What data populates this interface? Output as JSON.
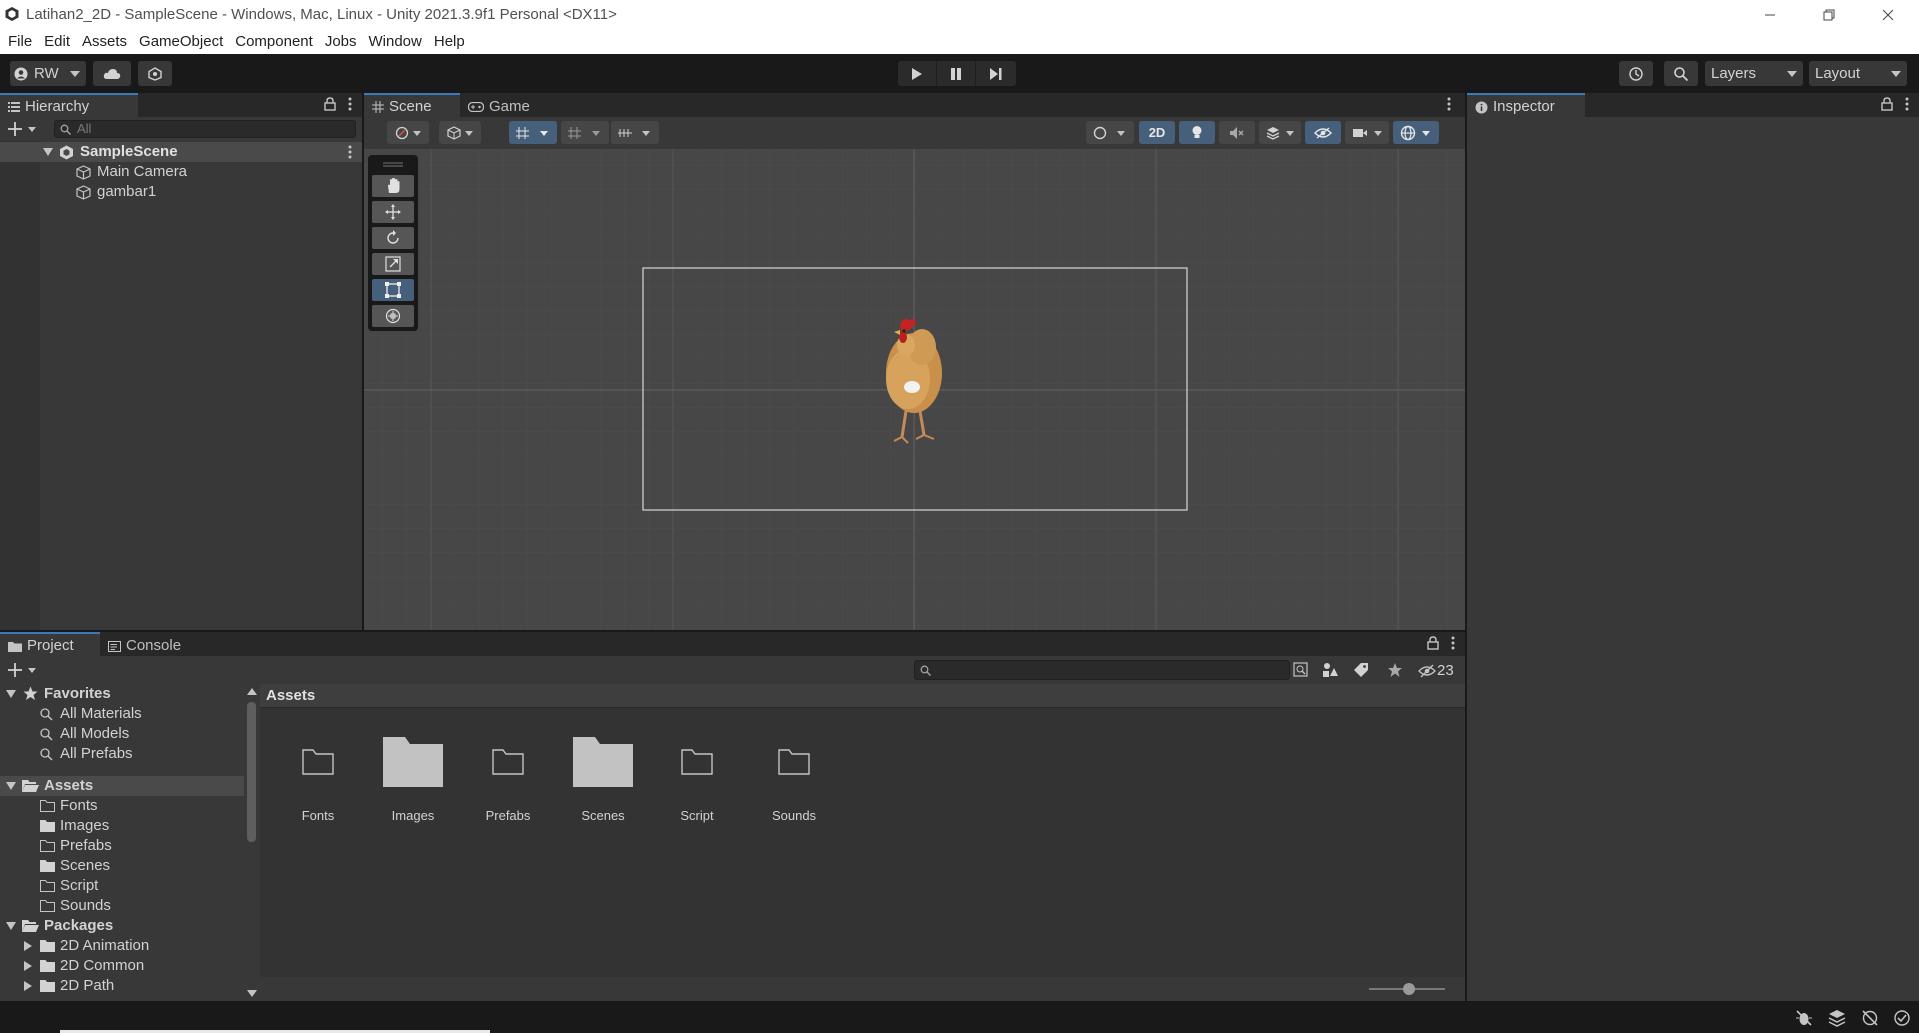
{
  "window": {
    "title": "Latihan2_2D - SampleScene - Windows, Mac, Linux - Unity 2021.3.9f1 Personal <DX11>"
  },
  "menu": [
    "File",
    "Edit",
    "Assets",
    "GameObject",
    "Component",
    "Jobs",
    "Window",
    "Help"
  ],
  "toolbar": {
    "account_label": "RW",
    "layers_label": "Layers",
    "layout_label": "Layout"
  },
  "hierarchy": {
    "tab_label": "Hierarchy",
    "search_placeholder": "All",
    "scene_name": "SampleScene",
    "objects": [
      "Main Camera",
      "gambar1"
    ]
  },
  "scene": {
    "tab_scene": "Scene",
    "tab_game": "Game",
    "mode_2d": "2D"
  },
  "inspector": {
    "tab_label": "Inspector"
  },
  "project": {
    "tab_project": "Project",
    "tab_console": "Console",
    "hidden_count": "23",
    "favorites_header": "Favorites",
    "favorites": [
      "All Materials",
      "All Models",
      "All Prefabs"
    ],
    "assets_header": "Assets",
    "asset_folders": [
      "Fonts",
      "Images",
      "Prefabs",
      "Scenes",
      "Script",
      "Sounds"
    ],
    "packages_header": "Packages",
    "packages": [
      "2D Animation",
      "2D Common",
      "2D Path"
    ],
    "breadcrumb": "Assets",
    "grid_items": [
      {
        "label": "Fonts",
        "filled": false
      },
      {
        "label": "Images",
        "filled": true
      },
      {
        "label": "Prefabs",
        "filled": false
      },
      {
        "label": "Scenes",
        "filled": true
      },
      {
        "label": "Script",
        "filled": false
      },
      {
        "label": "Sounds",
        "filled": false
      }
    ]
  },
  "colors": {
    "accent": "#3a79bb",
    "panel": "#383838",
    "dark": "#191919"
  }
}
